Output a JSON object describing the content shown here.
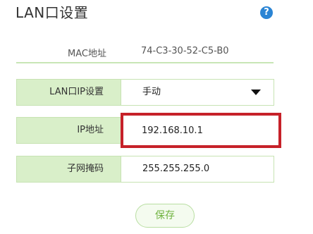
{
  "header": {
    "title": "LAN口设置",
    "help_glyph": "?"
  },
  "mac": {
    "label": "MAC地址",
    "value": "74-C3-30-52-C5-B0"
  },
  "form": {
    "lan_ip_setting": {
      "label": "LAN口IP设置",
      "value": "手动"
    },
    "ip_address": {
      "label": "IP地址",
      "value": "192.168.10.1"
    },
    "subnet_mask": {
      "label": "子网掩码",
      "value": "255.255.255.0"
    }
  },
  "actions": {
    "save_label": "保存"
  },
  "colors": {
    "accent_green": "#6fb33f",
    "label_bg": "#d9efc9",
    "highlight_red": "#c62129",
    "help_blue": "#2a84d4"
  },
  "icons": {
    "help": "help-icon",
    "dropdown": "caret-down-icon"
  }
}
